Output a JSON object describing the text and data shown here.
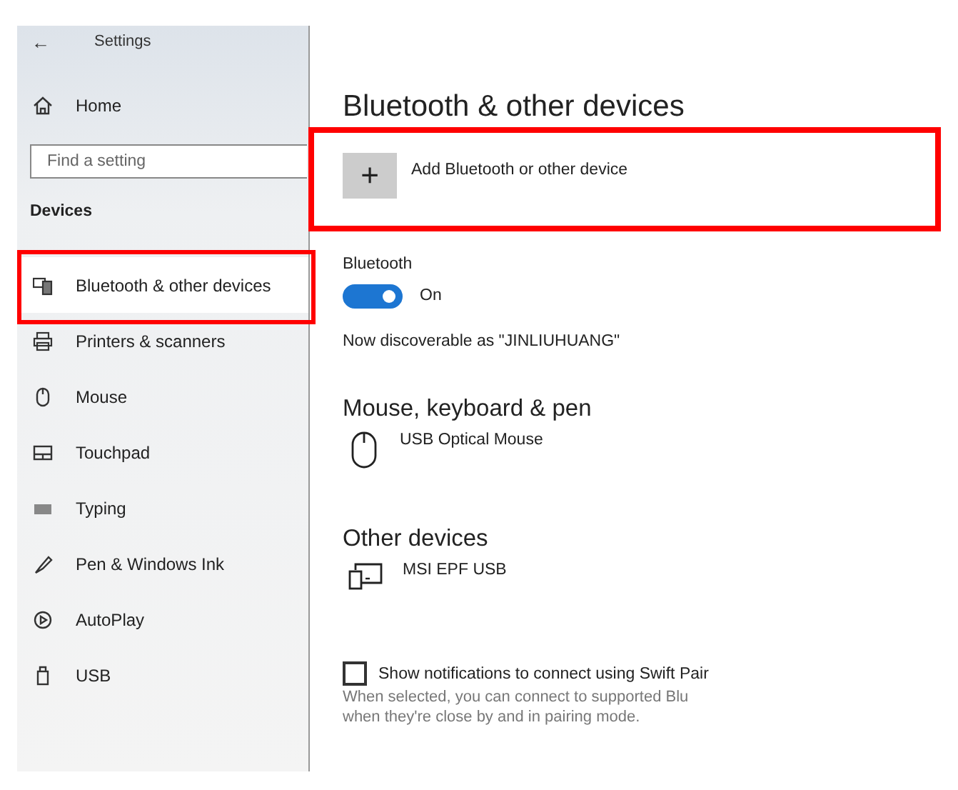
{
  "window": {
    "title": "Settings",
    "back_icon": "←"
  },
  "sidebar": {
    "home": "Home",
    "search": {
      "placeholder": "Find a setting"
    },
    "section": "Devices",
    "items": [
      {
        "label": "Bluetooth & other devices",
        "kind": "bluetooth",
        "selected": true,
        "highlighted": true
      },
      {
        "label": "Printers & scanners",
        "kind": "printer",
        "selected": false,
        "highlighted": false
      },
      {
        "label": "Mouse",
        "kind": "mouse",
        "selected": false,
        "highlighted": false
      },
      {
        "label": "Touchpad",
        "kind": "touchpad",
        "selected": false,
        "highlighted": false
      },
      {
        "label": "Typing",
        "kind": "keyboard",
        "selected": false,
        "highlighted": false
      },
      {
        "label": "Pen & Windows Ink",
        "kind": "pen",
        "selected": false,
        "highlighted": false
      },
      {
        "label": "AutoPlay",
        "kind": "autoplay",
        "selected": false,
        "highlighted": false
      },
      {
        "label": "USB",
        "kind": "usb",
        "selected": false,
        "highlighted": false
      }
    ]
  },
  "content": {
    "title": "Bluetooth & other devices",
    "add_device": {
      "icon": "+",
      "label": "Add Bluetooth or other device",
      "highlighted": true
    },
    "bluetooth": {
      "label": "Bluetooth",
      "on": true,
      "state_text": "On"
    },
    "discoverable": "Now discoverable as \"JINLIUHUANG\"",
    "groups": [
      {
        "heading": "Mouse, keyboard & pen",
        "devices": [
          {
            "name": "USB Optical Mouse",
            "kind": "mouse"
          }
        ]
      },
      {
        "heading": "Other devices",
        "devices": [
          {
            "name": "MSI EPF USB",
            "kind": "other"
          }
        ]
      }
    ],
    "swift_pair": {
      "label": "Show notifications to connect using Swift Pair",
      "checked": false,
      "hint": [
        "When selected, you can connect to supported Blu",
        "when they're close by and in pairing mode."
      ]
    }
  }
}
